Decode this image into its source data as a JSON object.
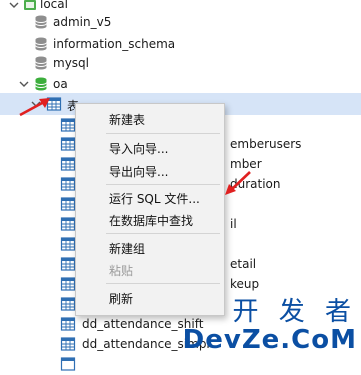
{
  "tree": {
    "connection": {
      "label": "local"
    },
    "databases": [
      {
        "label": "admin_v5"
      },
      {
        "label": "information_schema"
      },
      {
        "label": "mysql"
      },
      {
        "label": "oa"
      }
    ],
    "selected_node": {
      "label": "表"
    },
    "table_rows_right": [
      "emberusers",
      "mber",
      "duration",
      "il",
      "etail",
      "keup"
    ],
    "tables": [
      {
        "label": "dd_attendance_shift"
      },
      {
        "label": "dd_attendance_simpl"
      }
    ]
  },
  "context_menu": {
    "items": [
      {
        "label": "新建表",
        "disabled": false
      },
      {
        "label": "导入向导...",
        "disabled": false
      },
      {
        "label": "导出向导...",
        "disabled": false
      },
      {
        "label": "运行 SQL 文件...",
        "disabled": false
      },
      {
        "label": "在数据库中查找",
        "disabled": false
      },
      {
        "label": "新建组",
        "disabled": false
      },
      {
        "label": "粘贴",
        "disabled": true
      },
      {
        "label": "刷新",
        "disabled": false
      }
    ]
  },
  "watermark": {
    "line1": "开 发 者",
    "line2": "DevZe.CoM",
    "small": "n/n"
  },
  "colors": {
    "selected_row": "#d6e4f7",
    "arrow": "#e02020",
    "db_icon_gray": "#8e8e8e",
    "db_icon_green": "#3cae3c",
    "table_icon": "#2f6fb3",
    "watermark": "#0b4fa3"
  }
}
